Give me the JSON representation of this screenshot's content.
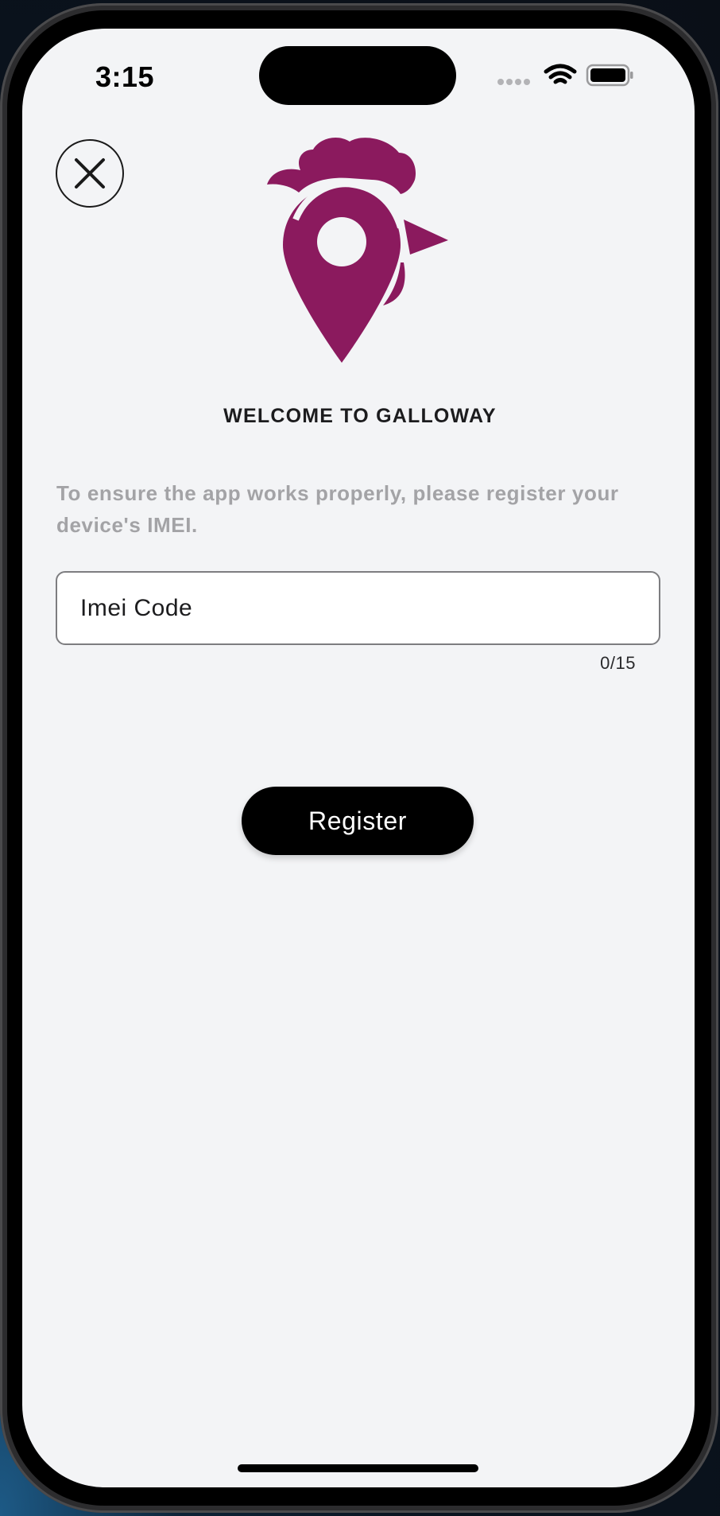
{
  "status_bar": {
    "time": "3:15",
    "icons": [
      "cellular-signal-icon",
      "wifi-icon",
      "battery-icon"
    ]
  },
  "header": {
    "close_icon": "close-icon",
    "logo": "galloway-rooster-pin-logo"
  },
  "welcome_title": "WELCOME TO GALLOWAY",
  "intro_text": "To ensure the app works properly, please register your device's IMEI.",
  "imei_input": {
    "placeholder": "Imei Code",
    "value": "",
    "counter": "0/15"
  },
  "register_button": {
    "label": "Register"
  },
  "colors": {
    "brand": "#8b1a5e",
    "button_bg": "#000000",
    "button_text": "#ffffff",
    "screen_bg": "#f3f4f6",
    "muted_text": "#a3a3a6"
  }
}
